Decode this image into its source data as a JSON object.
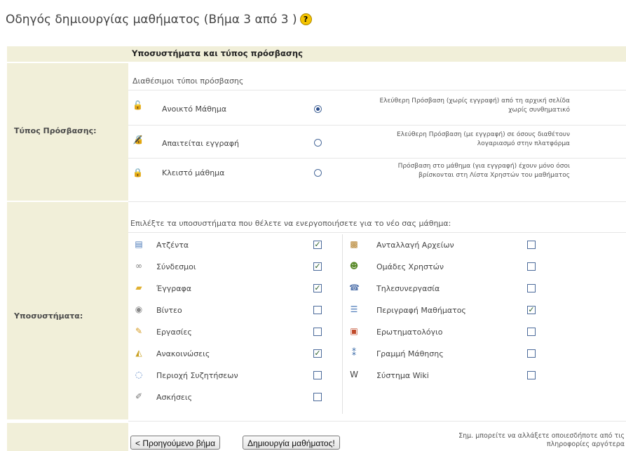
{
  "page": {
    "title": "Οδηγός δημιουργίας μαθήματος (Βήμα 3 από 3 )",
    "help_icon": "?"
  },
  "section_header": "Υποσυστήματα και τύπος πρόσβασης",
  "access": {
    "label": "Τύπος Πρόσβασης:",
    "intro": "Διαθέσιμοι τύποι πρόσβασης",
    "options": [
      {
        "icon": "open-lock-icon",
        "name": "Ανοικτό Μάθημα",
        "selected": true,
        "desc1": "Ελεύθερη Πρόσβαση (χωρίς εγγραφή) από τη αρχική σελίδα",
        "desc2": "χωρίς συνθηματικό"
      },
      {
        "icon": "registration-lock-icon",
        "name": "Απαιτείται εγγραφή",
        "selected": false,
        "desc1": "Ελεύθερη Πρόσβαση (με εγγραφή) σε όσους διαθέτουν",
        "desc2": "λογαριασμό στην πλατφόρμα"
      },
      {
        "icon": "closed-lock-icon",
        "name": "Κλειστό μάθημα",
        "selected": false,
        "desc1": "Πρόσβαση στο μάθημα (για εγγραφή) έχουν μόνο όσοι",
        "desc2": "βρίσκονται στη Λίστα Χρηστών του μαθήματος"
      }
    ]
  },
  "subsystems": {
    "label": "Υποσυστήματα:",
    "intro": "Επιλέξτε τα υποσυστήματα που θέλετε να ενεργοποιήσετε για το νέο σας μάθημα:",
    "left": [
      {
        "icon": "agenda-icon",
        "name": "Ατζέντα",
        "checked": true
      },
      {
        "icon": "links-icon",
        "name": "Σύνδεσμοι",
        "checked": true
      },
      {
        "icon": "documents-icon",
        "name": "Έγγραφα",
        "checked": true
      },
      {
        "icon": "video-icon",
        "name": "Βίντεο",
        "checked": false
      },
      {
        "icon": "assignments-icon",
        "name": "Εργασίες",
        "checked": false
      },
      {
        "icon": "announcements-icon",
        "name": "Ανακοινώσεις",
        "checked": true
      },
      {
        "icon": "discussion-icon",
        "name": "Περιοχή Συζητήσεων",
        "checked": false
      },
      {
        "icon": "exercises-icon",
        "name": "Ασκήσεις",
        "checked": false
      }
    ],
    "right": [
      {
        "icon": "file-exchange-icon",
        "name": "Ανταλλαγή Αρχείων",
        "checked": false
      },
      {
        "icon": "user-groups-icon",
        "name": "Ομάδες Χρηστών",
        "checked": false
      },
      {
        "icon": "teleconference-icon",
        "name": "Τηλεσυνεργασία",
        "checked": false
      },
      {
        "icon": "course-description-icon",
        "name": "Περιγραφή Μαθήματος",
        "checked": true
      },
      {
        "icon": "questionnaire-icon",
        "name": "Ερωτηματολόγιο",
        "checked": false
      },
      {
        "icon": "learning-path-icon",
        "name": "Γραμμή Μάθησης",
        "checked": false
      },
      {
        "icon": "wiki-icon",
        "name": "Σύστημα Wiki",
        "checked": false
      }
    ]
  },
  "footer": {
    "back_button": "< Προηγούμενο βήμα",
    "create_button": "Δημιουργία μαθήματος!",
    "note1": "Σημ. μπορείτε να αλλάξετε οποιεσδήποτε από τις",
    "note2": "πληροφορίες αργότερα"
  },
  "colors": {
    "label_bg": "#f1efd9",
    "accent": "#2a4c8a"
  }
}
